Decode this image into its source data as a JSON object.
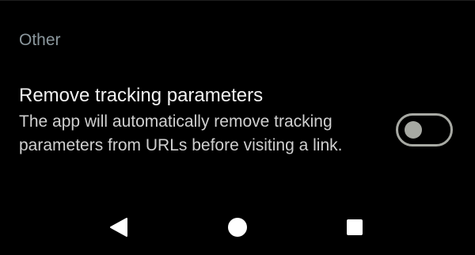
{
  "section": {
    "title": "Other"
  },
  "setting": {
    "title": "Remove tracking parameters",
    "description": "The app will automatically remove tracking parameters from URLs before visiting a link.",
    "toggle_on": false
  },
  "nav_bar": {
    "back_icon": "back-triangle-icon",
    "home_icon": "home-circle-icon",
    "recents_icon": "recents-square-icon"
  },
  "colors": {
    "background": "#000000",
    "section_header": "#8b979d",
    "title_text": "#f2f2f2",
    "description_text": "#d0d0d0",
    "toggle_off": "#a7a9a3",
    "nav_icons": "#ffffff"
  }
}
